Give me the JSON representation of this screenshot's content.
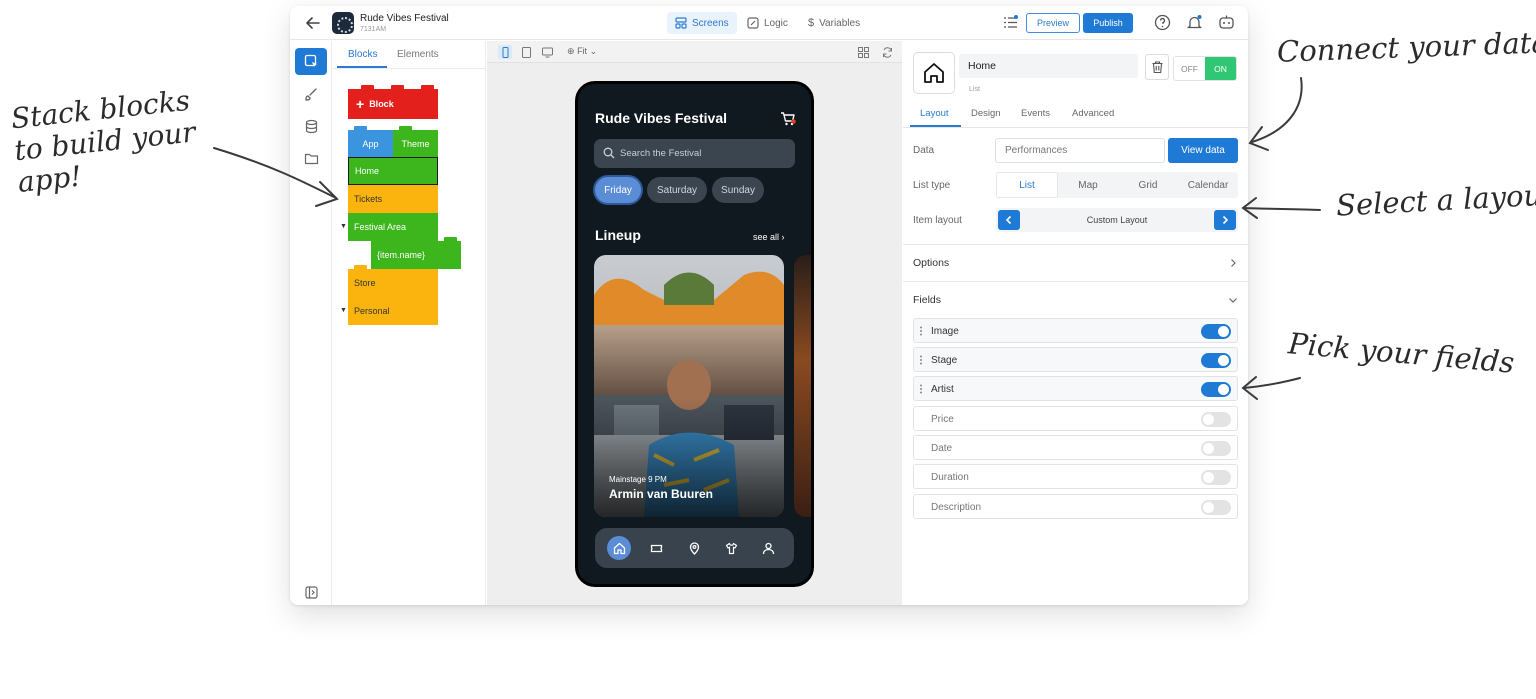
{
  "callouts": {
    "left": "Stack blocks to build your app!",
    "connect": "Connect your data",
    "layout": "Select a layout",
    "fields": "Pick your fields"
  },
  "topbar": {
    "app_name": "Rude Vibes Festival",
    "app_id": "7131AM",
    "tabs": [
      "Screens",
      "Logic",
      "Variables"
    ],
    "preview_label": "Preview",
    "publish_label": "Publish"
  },
  "blocks_panel": {
    "tabs": [
      "Blocks",
      "Elements"
    ],
    "add_block": "Block",
    "app_label": "App",
    "theme_label": "Theme",
    "screens": [
      "Home",
      "Tickets",
      "Festival Area",
      "{item.name}",
      "Store",
      "Personal"
    ]
  },
  "canvas": {
    "zoom_label": "Fit"
  },
  "phone": {
    "title": "Rude Vibes Festival",
    "search_placeholder": "Search the Festival",
    "days": [
      "Friday",
      "Saturday",
      "Sunday"
    ],
    "lineup_label": "Lineup",
    "see_all": "see all",
    "card_stage": "Mainstage 9 PM",
    "card_artist": "Armin van Buuren"
  },
  "properties": {
    "component_name": "Home",
    "component_type": "List",
    "toggle_off": "OFF",
    "toggle_on": "ON",
    "tabs": [
      "Layout",
      "Design",
      "Events",
      "Advanced"
    ],
    "data_label": "Data",
    "data_value": "Performances",
    "view_data": "View data",
    "list_type_label": "List type",
    "list_types": [
      "List",
      "Map",
      "Grid",
      "Calendar"
    ],
    "item_layout_label": "Item layout",
    "item_layout_value": "Custom Layout",
    "options_label": "Options",
    "fields_label": "Fields",
    "fields": [
      {
        "name": "Image",
        "enabled": true
      },
      {
        "name": "Stage",
        "enabled": true
      },
      {
        "name": "Artist",
        "enabled": true
      },
      {
        "name": "Price",
        "enabled": false
      },
      {
        "name": "Date",
        "enabled": false
      },
      {
        "name": "Duration",
        "enabled": false
      },
      {
        "name": "Description",
        "enabled": false
      }
    ]
  },
  "colors": {
    "accent": "#1f7ad6",
    "on_green": "#2fc774",
    "block_red": "#e3201c",
    "block_blue": "#3a95de",
    "block_green": "#3db51c",
    "block_orange": "#fbb40e",
    "phone_bg": "#101820"
  }
}
